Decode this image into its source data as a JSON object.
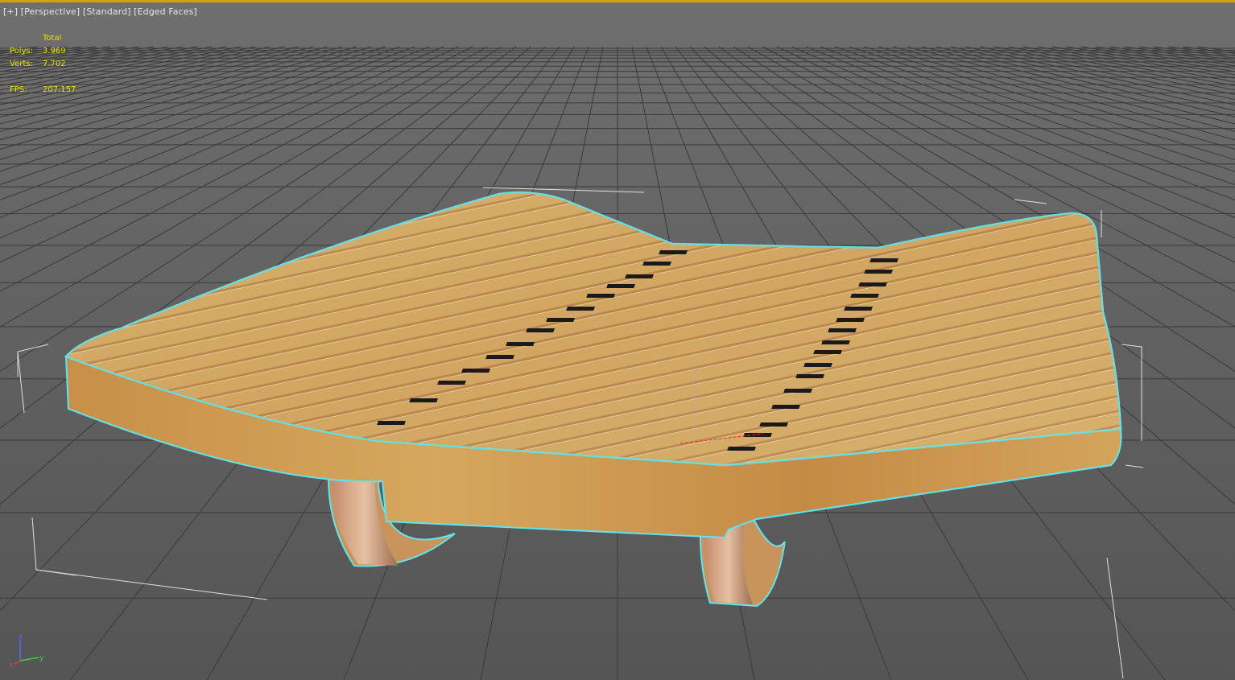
{
  "viewport": {
    "label_parts": [
      "[+]",
      "[Perspective]",
      "[Standard]",
      "[Edged Faces]"
    ]
  },
  "stats": {
    "header": "Total",
    "polys_label": "Polys:",
    "polys_value": "3.969",
    "verts_label": "Verts:",
    "verts_value": "7.702",
    "fps_label": "FPS:",
    "fps_value": "207,157"
  },
  "axis_gizmo": {
    "x": "x",
    "y": "y",
    "z": "z"
  },
  "colors": {
    "accent_border": "#d8a300",
    "selection_outline": "#5de6f2",
    "stats_text": "#e8e000",
    "grid_line": "#3a3a3a",
    "wood_light": "#d8b16a",
    "wood_dark": "#a8743e"
  }
}
